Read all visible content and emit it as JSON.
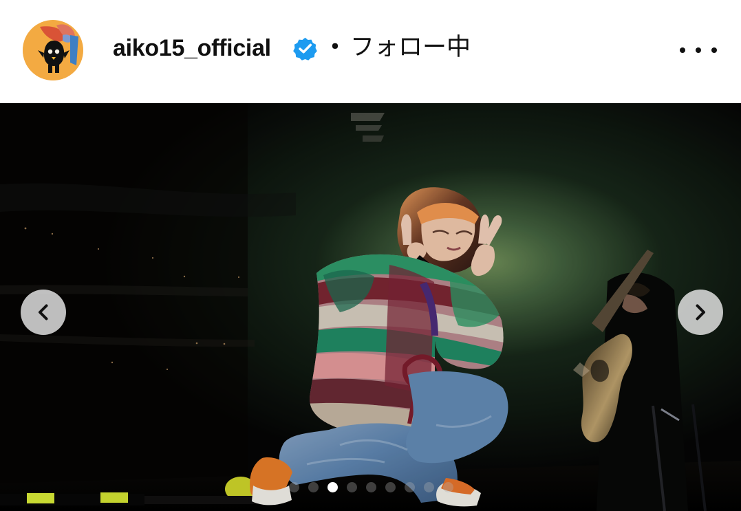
{
  "account": {
    "username": "aiko15_official",
    "verified_icon": "verified-badge-icon",
    "separator": "・",
    "follow_status": "フォロー中",
    "more_icon": "more-options-icon"
  },
  "media": {
    "description": "concert photo",
    "previous_icon": "chevron-left-icon",
    "next_icon": "chevron-right-icon",
    "carousel": {
      "total": 9,
      "active_index": 2
    }
  },
  "colors": {
    "background": "#ffffff",
    "text": "#111111",
    "verified": "#1d9bf0",
    "photo_dark": "#070706",
    "stage_green": "#2f4a2d",
    "accent_orange": "#f38c2c"
  }
}
